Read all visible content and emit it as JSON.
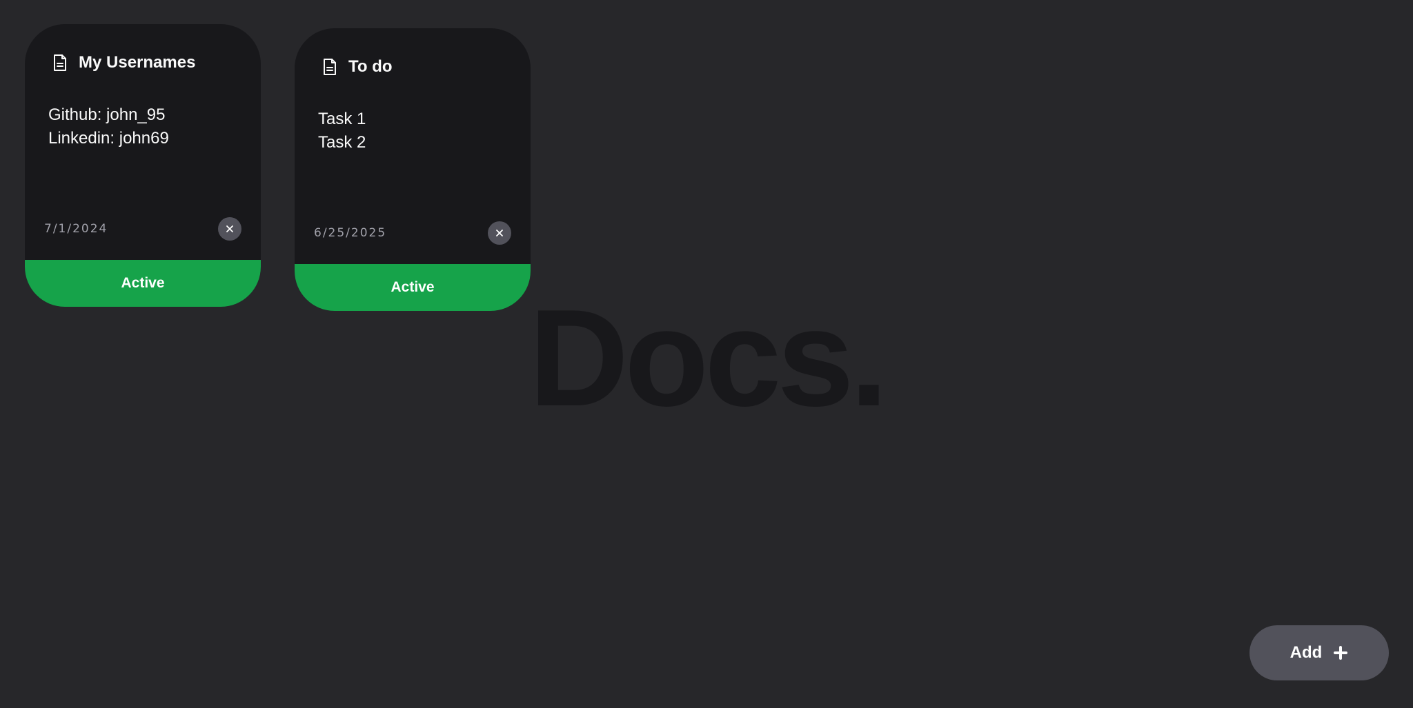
{
  "watermark": {
    "text": "Docs."
  },
  "notes": [
    {
      "title": "My Usernames",
      "lines": [
        "Github: john_95",
        "Linkedin: john69"
      ],
      "date": "7/1/2024",
      "status": "Active"
    },
    {
      "title": "To do",
      "lines": [
        "Task 1",
        "Task 2"
      ],
      "date": "6/25/2025",
      "status": "Active"
    }
  ],
  "add_button": {
    "label": "Add",
    "icon": "plus-icon"
  },
  "icons": {
    "note": "document-icon",
    "delete": "close-icon"
  },
  "colors": {
    "background": "#27272a",
    "card": "#18181b",
    "status_active": "#16a34a",
    "button": "#52525b",
    "watermark": "#18181b"
  }
}
